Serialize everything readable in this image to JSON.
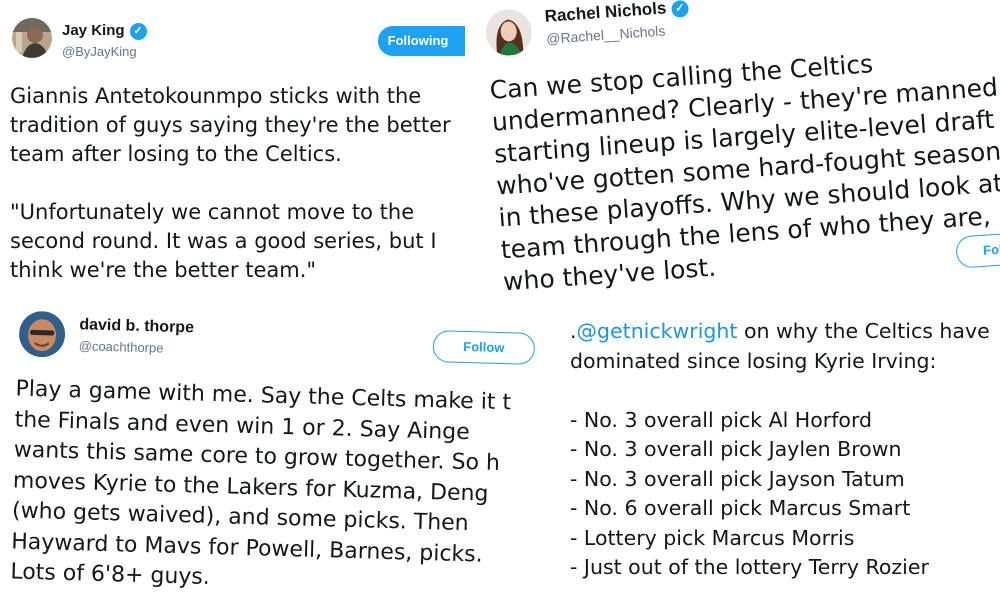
{
  "tweets": {
    "jay_king": {
      "display_name": "Jay King",
      "handle": "@ByJayKing",
      "follow_label": "Following",
      "lines": [
        "Giannis Antetokounmpo sticks with the",
        "tradition of guys saying they're the better",
        "team after losing to the Celtics.",
        "",
        "\"Unfortunately we cannot move to the",
        "second round. It was a good series, but I",
        "think we're the better team.\""
      ]
    },
    "rachel_nichols": {
      "display_name": "Rachel Nichols",
      "handle": "@Rachel__Nichols",
      "follow_label": "Follo",
      "lines": [
        "Can we stop calling the Celtics",
        "undermanned? Clearly - they're manned: t",
        "starting lineup is largely elite-level draft p",
        "who've gotten some hard-fought season",
        "in these playoffs. Why we should look at",
        "team through the lens of who they are,",
        "who they've lost."
      ]
    },
    "david_thorpe": {
      "display_name": "david b. thorpe",
      "handle": "@coachthorpe",
      "follow_label": "Follow",
      "lines": [
        "Play a game with me. Say the Celts make it t",
        "the Finals and even win 1 or 2. Say Ainge",
        "wants this same core to grow together. So h",
        "moves Kyrie to the Lakers for Kuzma, Deng",
        "(who gets waived), and some picks. Then",
        "Hayward to Mavs for Powell, Barnes, picks.",
        "Lots of 6'8+ guys."
      ]
    },
    "nick_wright_quote": {
      "prefix": ".",
      "mention": "@getnickwright",
      "line1_rest": " on why the Celtics have",
      "line2": "dominated since losing Kyrie Irving:",
      "picks": [
        "- No. 3 overall pick Al Horford",
        "- No. 3 overall pick Jaylen Brown",
        "- No. 3 overall pick Jayson Tatum",
        "- No. 6 overall pick Marcus Smart",
        "- Lottery pick Marcus Morris",
        "- Just out of the lottery Terry Rozier"
      ]
    }
  },
  "colors": {
    "twitter_blue": "#1da1f2",
    "link_blue": "#1b95e0",
    "text": "#14171a",
    "handle_gray": "#657786"
  }
}
